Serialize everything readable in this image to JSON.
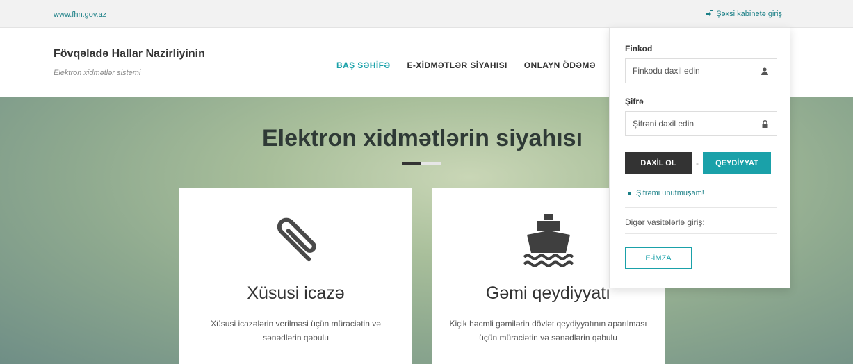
{
  "topbar": {
    "site": "www.fhn.gov.az",
    "login_link": "Şəxsi kabinetə giriş",
    "login_icon": "sign-in-icon"
  },
  "header": {
    "title": "Fövqəladə Hallar Nazirliyinin",
    "subtitle": "Elektron xidmətlər sistemi",
    "nav": [
      {
        "label": "BAŞ SƏHİFƏ",
        "active": true
      },
      {
        "label": "E-XİDMƏTLƏR SİYAHISI",
        "active": false
      },
      {
        "label": "ONLAYN ÖDƏMƏ",
        "active": false
      }
    ]
  },
  "hero": {
    "title": "Elektron xidmətlərin siyahısı"
  },
  "cards": [
    {
      "icon": "paperclip-icon",
      "title": "Xüsusi icazə",
      "description": "Xüsusi icazələrin verilməsi üçün müraciətin və sənədlərin qəbulu"
    },
    {
      "icon": "ship-icon",
      "title": "Gəmi qeydiyyatı",
      "description": "Kiçik həcmli gəmilərin dövlət qeydiyyatının aparılması üçün müraciətin və sənədlərin qəbulu"
    }
  ],
  "login_panel": {
    "finkod_label": "Finkod",
    "finkod_placeholder": "Finkodu daxil edin",
    "password_label": "Şifrə",
    "password_placeholder": "Şifrəni daxil edin",
    "login_button": "DAXİL OL",
    "separator": "-",
    "register_button": "QEYDİYYAT",
    "forgot_link": "Şifrəmi unutmuşam!",
    "other_methods": "Digər vasitələrlə giriş:",
    "eimza_button": "E-İMZA"
  },
  "colors": {
    "accent": "#1aa1a9",
    "dark_button": "#333333",
    "link": "#1a7f86"
  }
}
